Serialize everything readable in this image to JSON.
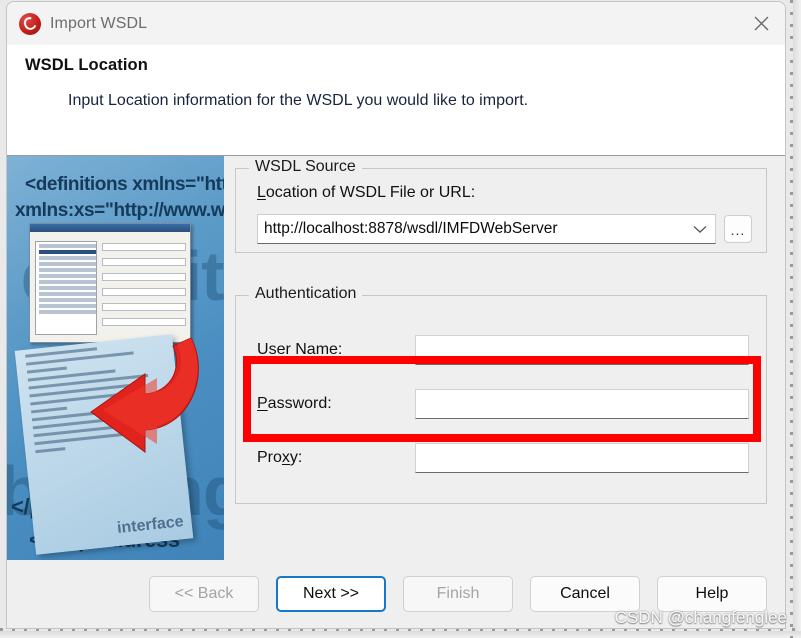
{
  "window": {
    "title": "Import WSDL",
    "icon": "app-logo-icon",
    "close_icon": "close-icon"
  },
  "header": {
    "title": "WSDL Location",
    "subtitle": "Input Location information for the WSDL you would like to import."
  },
  "banner": {
    "xml_lines": [
      "<definitions xmlns=\"htt",
      "xmlns:xs=\"http://www.w",
      "</port>",
      "<soap:address"
    ],
    "ghost_words": [
      "definiti",
      "binding=\""
    ],
    "paper_word": "interface"
  },
  "wsdl_source": {
    "legend": "WSDL Source",
    "location_label_mnemonic": "L",
    "location_label_rest": "ocation of WSDL File or URL:",
    "location_value": "http://localhost:8878/wsdl/IMFDWebServer",
    "location_placeholder": "",
    "dropdown_icon": "chevron-down-icon",
    "browse_label": "...",
    "highlight_color": "#fe0000"
  },
  "authentication": {
    "legend": "Authentication",
    "fields": [
      {
        "mnemonic": "U",
        "rest": "ser Name:",
        "value": "",
        "placeholder": "",
        "name": "user-name"
      },
      {
        "mnemonic": "P",
        "rest": "assword:",
        "value": "",
        "placeholder": "",
        "name": "password"
      },
      {
        "pre": "Pro",
        "mnemonic": "x",
        "rest": "y:",
        "value": "",
        "placeholder": "",
        "name": "proxy"
      }
    ]
  },
  "footer": {
    "buttons": [
      {
        "label": "<< Back",
        "state": "disabled"
      },
      {
        "label": "Next >>",
        "state": "default"
      },
      {
        "label": "Finish",
        "state": "disabled"
      },
      {
        "label": "Cancel",
        "state": "normal"
      },
      {
        "label": "Help",
        "state": "normal"
      }
    ]
  },
  "watermark": "CSDN @changfenglee"
}
